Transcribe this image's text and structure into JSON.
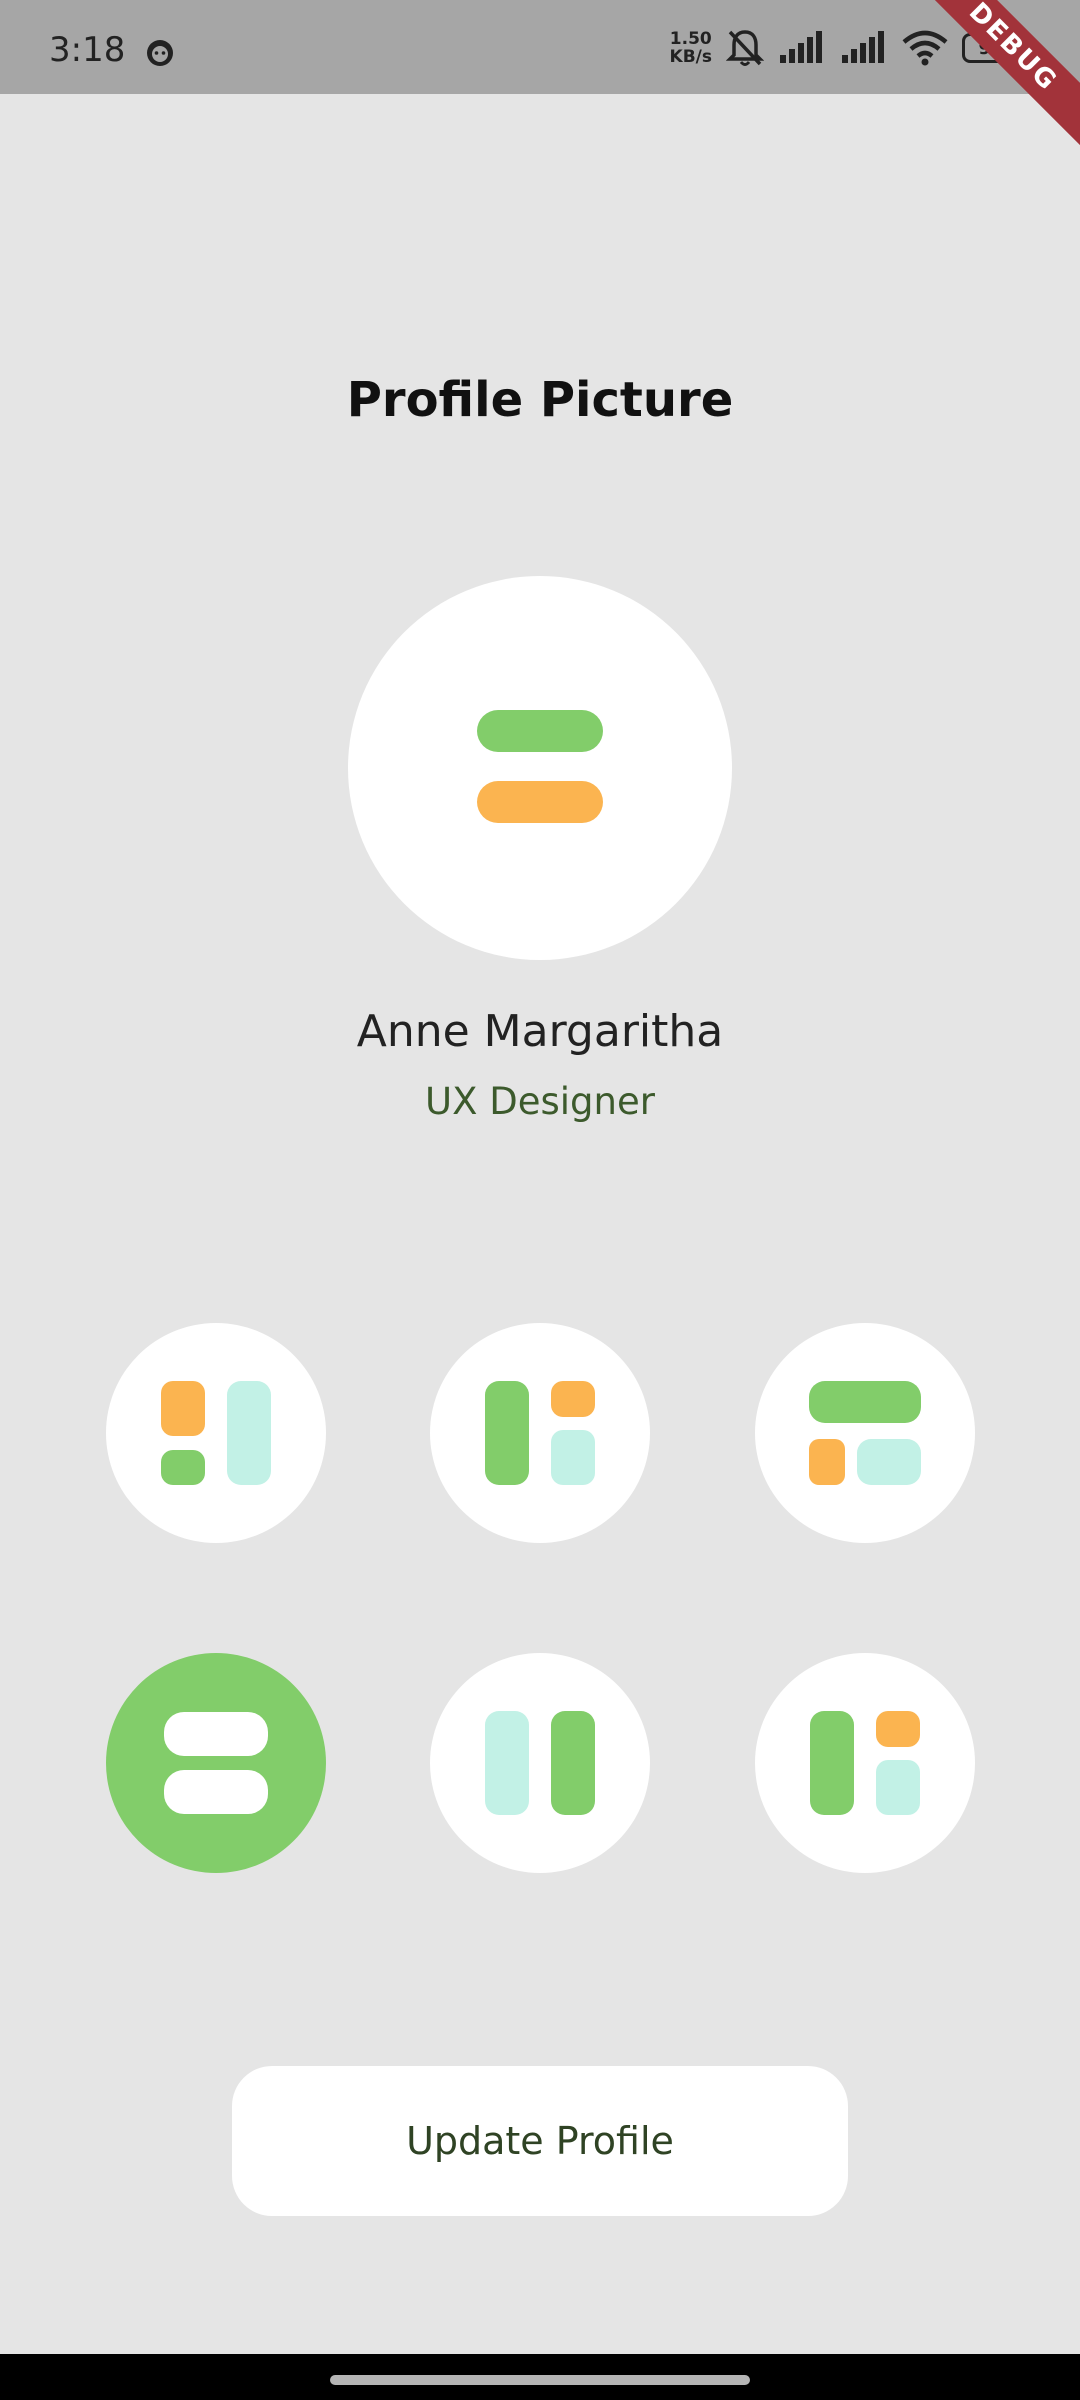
{
  "status_bar": {
    "time": "3:18",
    "net_speed_value": "1.50",
    "net_speed_unit": "KB/s",
    "battery": "99"
  },
  "debug_banner": "DEBUG",
  "page": {
    "title": "Profile Picture"
  },
  "profile": {
    "name": "Anne Margaritha",
    "role": "UX Designer"
  },
  "avatar_options": [
    {
      "layout": "orange-square-green-square-mint-tall",
      "selected": false
    },
    {
      "layout": "green-tall-orange-square-mint-square",
      "selected": false
    },
    {
      "layout": "green-wide-orange-square-mint-wide",
      "selected": false
    },
    {
      "layout": "two-white-pills-stacked",
      "selected": true
    },
    {
      "layout": "mint-tall-green-tall",
      "selected": false
    },
    {
      "layout": "green-tall-orange-square-mint-square",
      "selected": false
    }
  ],
  "update_button": {
    "label": "Update Profile"
  },
  "colors": {
    "background": "#e5e5e5",
    "green": "#82cd6a",
    "orange": "#fbb450",
    "mint": "#c2f1e6",
    "button_text": "#2f4324",
    "role_text": "#3c5a2c"
  }
}
